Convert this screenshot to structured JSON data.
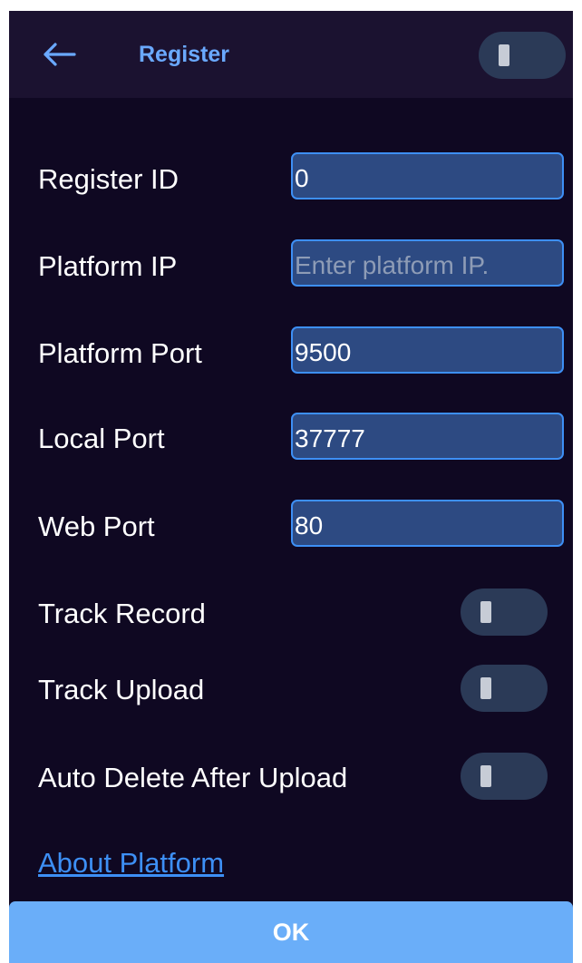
{
  "header": {
    "title": "Register",
    "back_icon": "arrow-left-icon",
    "toggle_on": false
  },
  "fields": [
    {
      "label": "Register ID",
      "value": "0",
      "placeholder": ""
    },
    {
      "label": "Platform IP",
      "value": "",
      "placeholder": "Enter platform IP."
    },
    {
      "label": "Platform Port",
      "value": "9500",
      "placeholder": ""
    },
    {
      "label": "Local Port",
      "value": "37777",
      "placeholder": ""
    },
    {
      "label": "Web Port",
      "value": "80",
      "placeholder": ""
    }
  ],
  "toggles": [
    {
      "label": "Track Record",
      "on": false
    },
    {
      "label": "Track Upload",
      "on": false
    },
    {
      "label": "Auto Delete After Upload",
      "on": false
    }
  ],
  "about_link": "About Platform",
  "ok_button": "OK",
  "colors": {
    "background": "#0f0822",
    "header_background": "#1b1230",
    "accent": "#6aa9ff",
    "field_background": "#2d4a82",
    "field_border": "#3d8ff5",
    "toggle_track": "#2b3a57",
    "ok_button": "#6aaef9"
  }
}
